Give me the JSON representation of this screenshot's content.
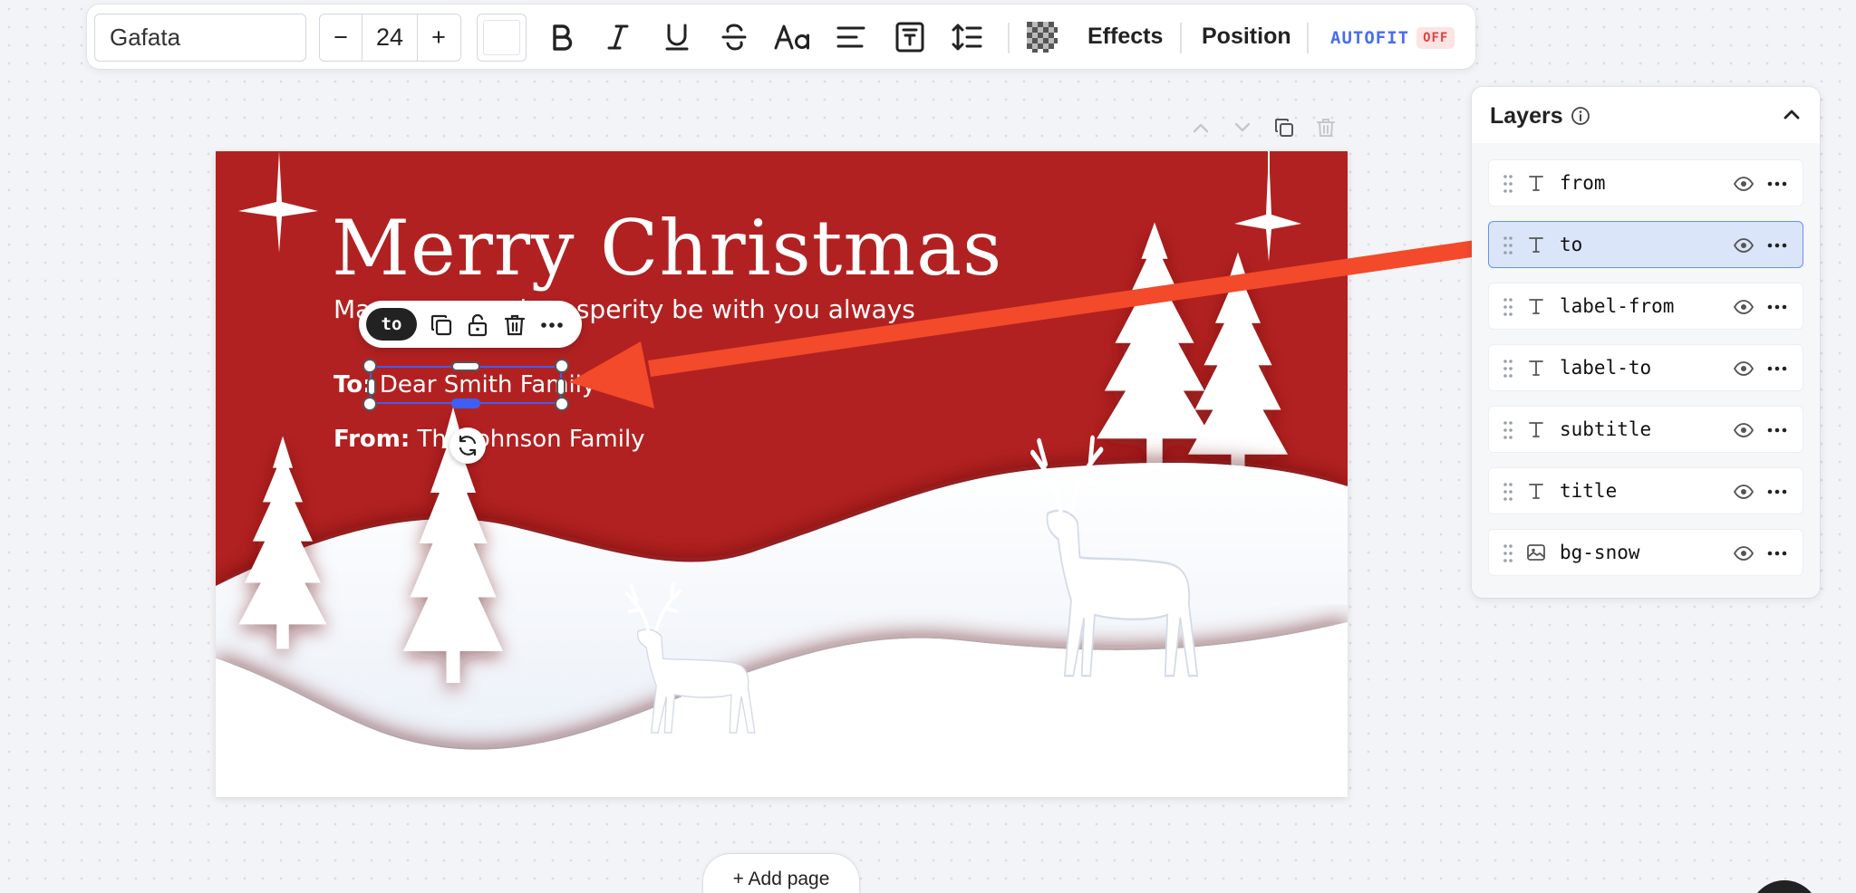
{
  "toolbar": {
    "font_name": "Gafata",
    "font_size": "24",
    "decrement_label": "−",
    "increment_label": "+",
    "text_color": "#ffffff",
    "effects_label": "Effects",
    "position_label": "Position",
    "autofit_label": "AUTOFIT",
    "autofit_state": "OFF"
  },
  "card": {
    "title": "Merry Christmas",
    "subtitle": "May peace and prosperity be with you always",
    "to_label": "To:",
    "to_value": "Dear Smith Family",
    "from_label": "From:",
    "from_value": "The Johnson Family",
    "background_color": "#b22121"
  },
  "context_toolbar": {
    "selected_layer": "to"
  },
  "layers": {
    "title": "Layers",
    "items": [
      {
        "name": "from",
        "type": "text",
        "selected": false
      },
      {
        "name": "to",
        "type": "text",
        "selected": true
      },
      {
        "name": "label-from",
        "type": "text",
        "selected": false
      },
      {
        "name": "label-to",
        "type": "text",
        "selected": false
      },
      {
        "name": "subtitle",
        "type": "text",
        "selected": false
      },
      {
        "name": "title",
        "type": "text",
        "selected": false
      },
      {
        "name": "bg-snow",
        "type": "image",
        "selected": false
      }
    ]
  },
  "footer": {
    "add_page_label": "+ Add page"
  },
  "colors": {
    "accent": "#3d5ff5",
    "annotation_arrow": "#f24a2a",
    "card_red": "#b22121"
  }
}
